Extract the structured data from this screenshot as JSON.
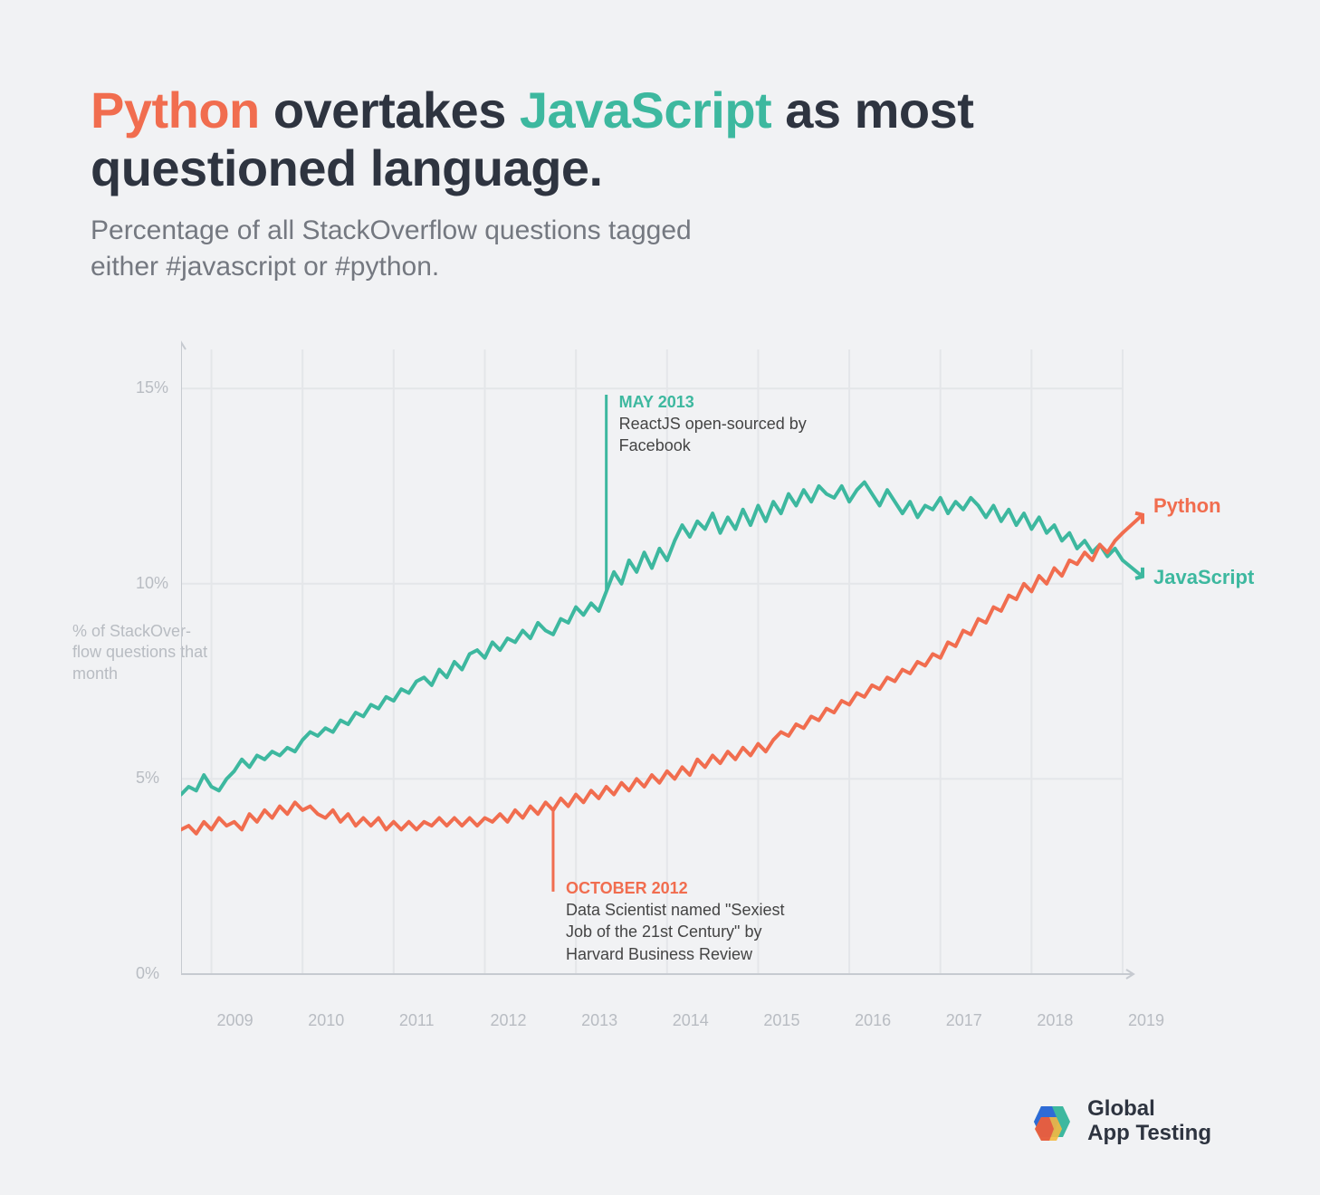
{
  "title": {
    "word_python": "Python",
    "mid1": " overtakes ",
    "word_js": "JavaScript",
    "mid2": " as most questioned language."
  },
  "subtitle": "Percentage of all StackOverflow questions tagged either #javascript or #python.",
  "yaxis_caption": "% of StackOver-flow questions that month",
  "chart_data": {
    "type": "line",
    "xlabel": "",
    "ylabel": "",
    "ylim": [
      0,
      16
    ],
    "y_ticks": [
      0,
      5,
      10,
      15
    ],
    "y_tick_labels": [
      "0%",
      "5%",
      "10%",
      "15%"
    ],
    "x_tick_year_labels": [
      "2009",
      "2010",
      "2011",
      "2012",
      "2013",
      "2014",
      "2015",
      "2016",
      "2017",
      "2018",
      "2019"
    ],
    "x_range_months": [
      "2008-09",
      "2019-01"
    ],
    "series": [
      {
        "name": "JavaScript",
        "color": "#3db89f",
        "values": [
          4.6,
          4.8,
          4.7,
          5.1,
          4.8,
          4.7,
          5.0,
          5.2,
          5.5,
          5.3,
          5.6,
          5.5,
          5.7,
          5.6,
          5.8,
          5.7,
          6.0,
          6.2,
          6.1,
          6.3,
          6.2,
          6.5,
          6.4,
          6.7,
          6.6,
          6.9,
          6.8,
          7.1,
          7.0,
          7.3,
          7.2,
          7.5,
          7.6,
          7.4,
          7.8,
          7.6,
          8.0,
          7.8,
          8.2,
          8.3,
          8.1,
          8.5,
          8.3,
          8.6,
          8.5,
          8.8,
          8.6,
          9.0,
          8.8,
          8.7,
          9.1,
          9.0,
          9.4,
          9.2,
          9.5,
          9.3,
          9.8,
          10.3,
          10.0,
          10.6,
          10.3,
          10.8,
          10.4,
          10.9,
          10.6,
          11.1,
          11.5,
          11.2,
          11.6,
          11.4,
          11.8,
          11.3,
          11.7,
          11.4,
          11.9,
          11.5,
          12.0,
          11.6,
          12.1,
          11.8,
          12.3,
          12.0,
          12.4,
          12.1,
          12.5,
          12.3,
          12.2,
          12.5,
          12.1,
          12.4,
          12.6,
          12.3,
          12.0,
          12.4,
          12.1,
          11.8,
          12.1,
          11.7,
          12.0,
          11.9,
          12.2,
          11.8,
          12.1,
          11.9,
          12.2,
          12.0,
          11.7,
          12.0,
          11.6,
          11.9,
          11.5,
          11.8,
          11.4,
          11.7,
          11.3,
          11.5,
          11.1,
          11.3,
          10.9,
          11.1,
          10.8,
          11.0,
          10.7,
          10.9,
          10.6
        ]
      },
      {
        "name": "Python",
        "color": "#f16d4f",
        "values": [
          3.7,
          3.8,
          3.6,
          3.9,
          3.7,
          4.0,
          3.8,
          3.9,
          3.7,
          4.1,
          3.9,
          4.2,
          4.0,
          4.3,
          4.1,
          4.4,
          4.2,
          4.3,
          4.1,
          4.0,
          4.2,
          3.9,
          4.1,
          3.8,
          4.0,
          3.8,
          4.0,
          3.7,
          3.9,
          3.7,
          3.9,
          3.7,
          3.9,
          3.8,
          4.0,
          3.8,
          4.0,
          3.8,
          4.0,
          3.8,
          4.0,
          3.9,
          4.1,
          3.9,
          4.2,
          4.0,
          4.3,
          4.1,
          4.4,
          4.2,
          4.5,
          4.3,
          4.6,
          4.4,
          4.7,
          4.5,
          4.8,
          4.6,
          4.9,
          4.7,
          5.0,
          4.8,
          5.1,
          4.9,
          5.2,
          5.0,
          5.3,
          5.1,
          5.5,
          5.3,
          5.6,
          5.4,
          5.7,
          5.5,
          5.8,
          5.6,
          5.9,
          5.7,
          6.0,
          6.2,
          6.1,
          6.4,
          6.3,
          6.6,
          6.5,
          6.8,
          6.7,
          7.0,
          6.9,
          7.2,
          7.1,
          7.4,
          7.3,
          7.6,
          7.5,
          7.8,
          7.7,
          8.0,
          7.9,
          8.2,
          8.1,
          8.5,
          8.4,
          8.8,
          8.7,
          9.1,
          9.0,
          9.4,
          9.3,
          9.7,
          9.6,
          10.0,
          9.8,
          10.2,
          10.0,
          10.4,
          10.2,
          10.6,
          10.5,
          10.8,
          10.6,
          11.0,
          10.8,
          11.1,
          11.3
        ]
      }
    ],
    "annotations": [
      {
        "series": "JavaScript",
        "date_label": "MAY 2013",
        "text": "ReactJS open-sourced by Facebook",
        "x_month_index": 56
      },
      {
        "series": "Python",
        "date_label": "OCTOBER 2012",
        "text": "Data Scientist named \"Sexiest Job of the 21st Century\" by Harvard Business Review",
        "x_month_index": 49
      }
    ],
    "end_labels": {
      "python": "Python",
      "javascript": "JavaScript"
    }
  },
  "footer": {
    "brand_line1": "Global",
    "brand_line2": "App Testing"
  }
}
